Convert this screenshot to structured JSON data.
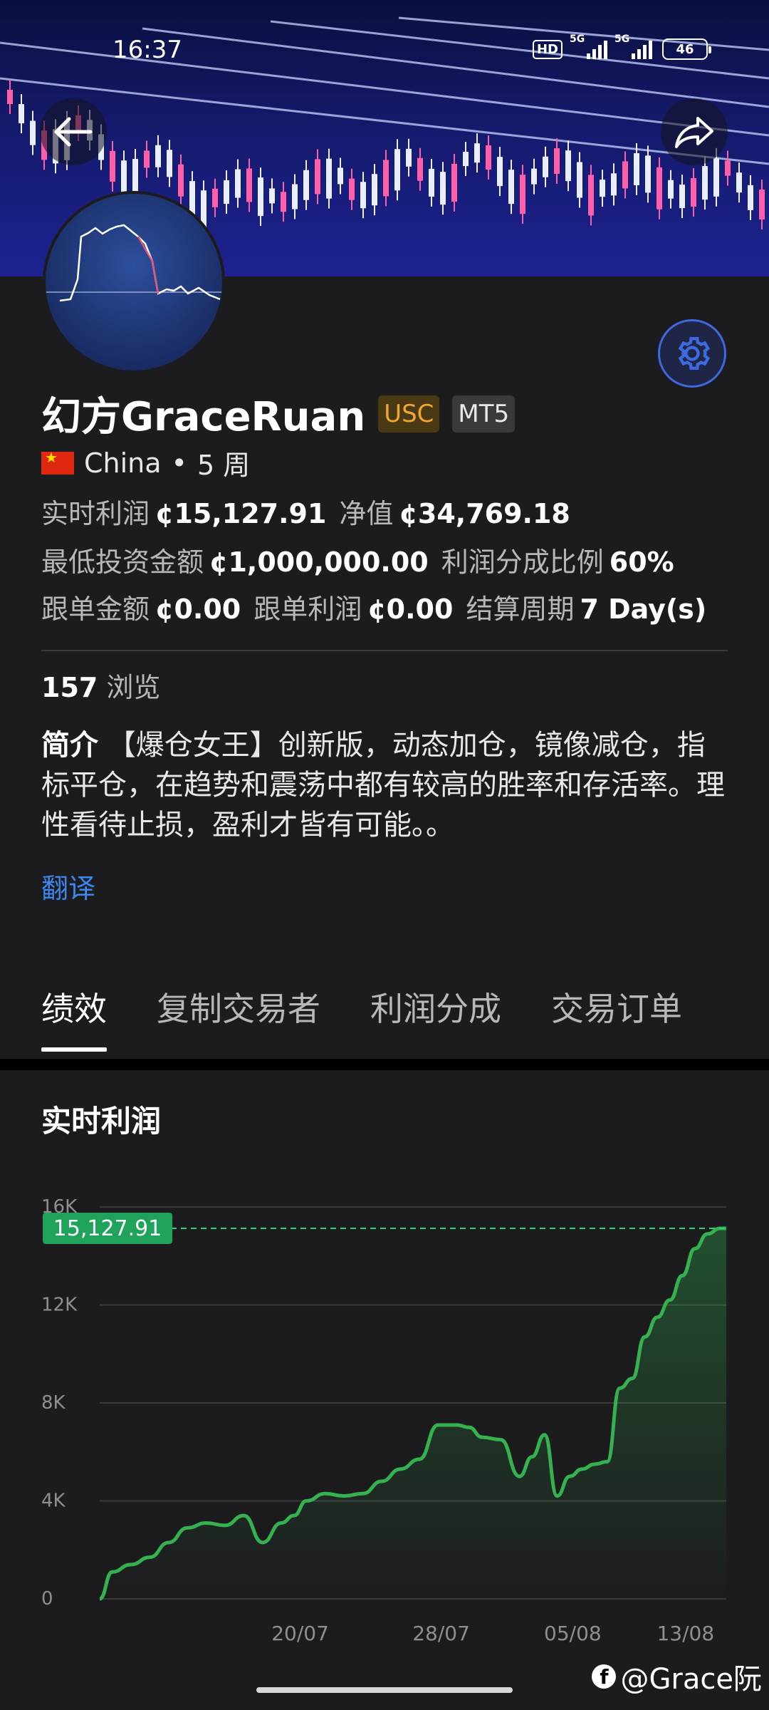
{
  "status_bar": {
    "time": "16:37",
    "hd": "HD",
    "signal1": "5G",
    "signal2": "5G",
    "battery": "46"
  },
  "profile": {
    "name": "幻方GraceRuan",
    "tags": [
      "USC",
      "MT5"
    ],
    "country": "China",
    "duration": "5 周",
    "realtime_profit_label": "实时利润",
    "realtime_profit_value": "¢15,127.91",
    "net_value_label": "净值",
    "net_value_value": "¢34,769.18",
    "min_invest_label": "最低投资金额",
    "min_invest_value": "¢1,000,000.00",
    "share_ratio_label": "利润分成比例",
    "share_ratio_value": "60%",
    "follow_amount_label": "跟单金额",
    "follow_amount_value": "¢0.00",
    "follow_profit_label": "跟单利润",
    "follow_profit_value": "¢0.00",
    "settle_label": "结算周期",
    "settle_value": "7 Day(s)",
    "views_count": "157",
    "views_label": "浏览",
    "intro_label": "简介",
    "intro_text": "【爆仓女王】创新版，动态加仓，镜像减仓，指标平仓，在趋势和震荡中都有较高的胜率和存活率。理性看待止损，盈利才皆有可能。。",
    "translate": "翻译"
  },
  "tabs": [
    "绩效",
    "复制交易者",
    "利润分成",
    "交易订单"
  ],
  "card_title": "实时利润",
  "watermark": "@Grace阮",
  "chart_data": {
    "type": "area",
    "title": "实时利润",
    "x_ticks": [
      "20/07",
      "28/07",
      "05/08",
      "13/08"
    ],
    "y_ticks": [
      "0",
      "4K",
      "8K",
      "12K",
      "16K"
    ],
    "ylim": [
      0,
      16000
    ],
    "current_value_label": "15,127.91",
    "current_value": 15127.91,
    "series": [
      {
        "x": [
          0,
          0.02,
          0.05,
          0.08,
          0.11,
          0.14,
          0.17,
          0.2,
          0.23,
          0.26,
          0.29,
          0.31,
          0.33,
          0.36,
          0.39,
          0.42,
          0.45,
          0.48,
          0.51,
          0.54,
          0.57,
          0.59,
          0.61,
          0.64,
          0.67,
          0.69,
          0.71,
          0.73,
          0.75,
          0.77,
          0.79,
          0.81,
          0.83,
          0.85,
          0.87,
          0.89,
          0.91,
          0.93,
          0.95,
          0.97,
          0.99,
          1.0
        ],
        "values": [
          0,
          1100,
          1400,
          1700,
          2300,
          2900,
          3100,
          3000,
          3400,
          2300,
          3100,
          3400,
          4000,
          4300,
          4200,
          4300,
          4800,
          5300,
          5700,
          7100,
          7100,
          7000,
          6600,
          6500,
          5000,
          5800,
          6700,
          4200,
          5000,
          5300,
          5500,
          5600,
          8600,
          9000,
          10700,
          11500,
          12200,
          13200,
          14300,
          14900,
          15127.91,
          15127.91
        ]
      }
    ]
  }
}
